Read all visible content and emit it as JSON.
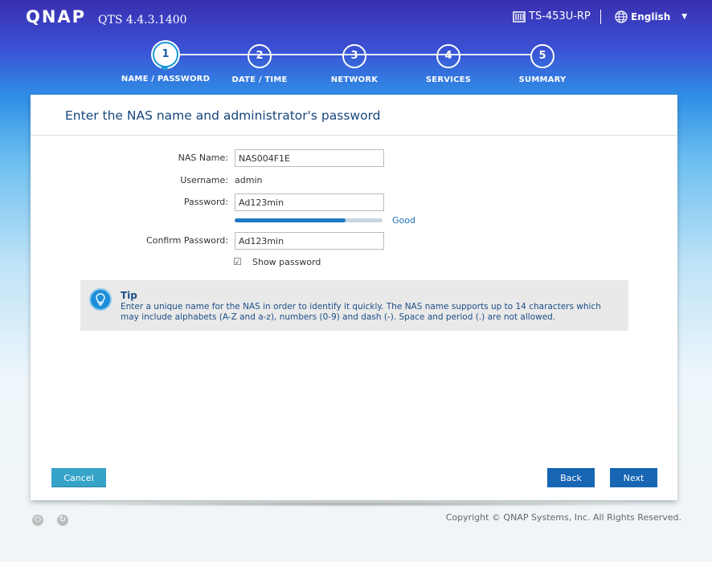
{
  "header": {
    "logo": "QNAP",
    "version": "QTS 4.4.3.1400",
    "model": "TS-453U-RP",
    "language": "English"
  },
  "steps": [
    {
      "num": "1",
      "label": "NAME / PASSWORD",
      "active": true
    },
    {
      "num": "2",
      "label": "DATE / TIME",
      "active": false
    },
    {
      "num": "3",
      "label": "NETWORK",
      "active": false
    },
    {
      "num": "4",
      "label": "SERVICES",
      "active": false
    },
    {
      "num": "5",
      "label": "SUMMARY",
      "active": false
    }
  ],
  "panel": {
    "title": "Enter the NAS name and administrator's password",
    "nas_name_label": "NAS Name:",
    "nas_name_value": "NAS004F1E",
    "username_label": "Username:",
    "username_value": "admin",
    "password_label": "Password:",
    "password_value": "Ad123min",
    "password_strength": "Good",
    "password_strength_fraction": 0.75,
    "confirm_label": "Confirm Password:",
    "confirm_value": "Ad123min",
    "show_password_label": "Show password",
    "show_password_checked": true
  },
  "tip": {
    "title": "Tip",
    "text": "Enter a unique name for the NAS in order to identify it quickly. The NAS name supports up to 14 characters which may include alphabets (A-Z and a-z), numbers (0-9) and dash (-). Space and period (.) are not allowed."
  },
  "buttons": {
    "cancel": "Cancel",
    "back": "Back",
    "next": "Next"
  },
  "footer": {
    "copyright": "Copyright © QNAP Systems, Inc. All Rights Reserved."
  },
  "colors": {
    "accent": "#1765b3",
    "cancel": "#36a3c8",
    "title": "#16467c"
  }
}
